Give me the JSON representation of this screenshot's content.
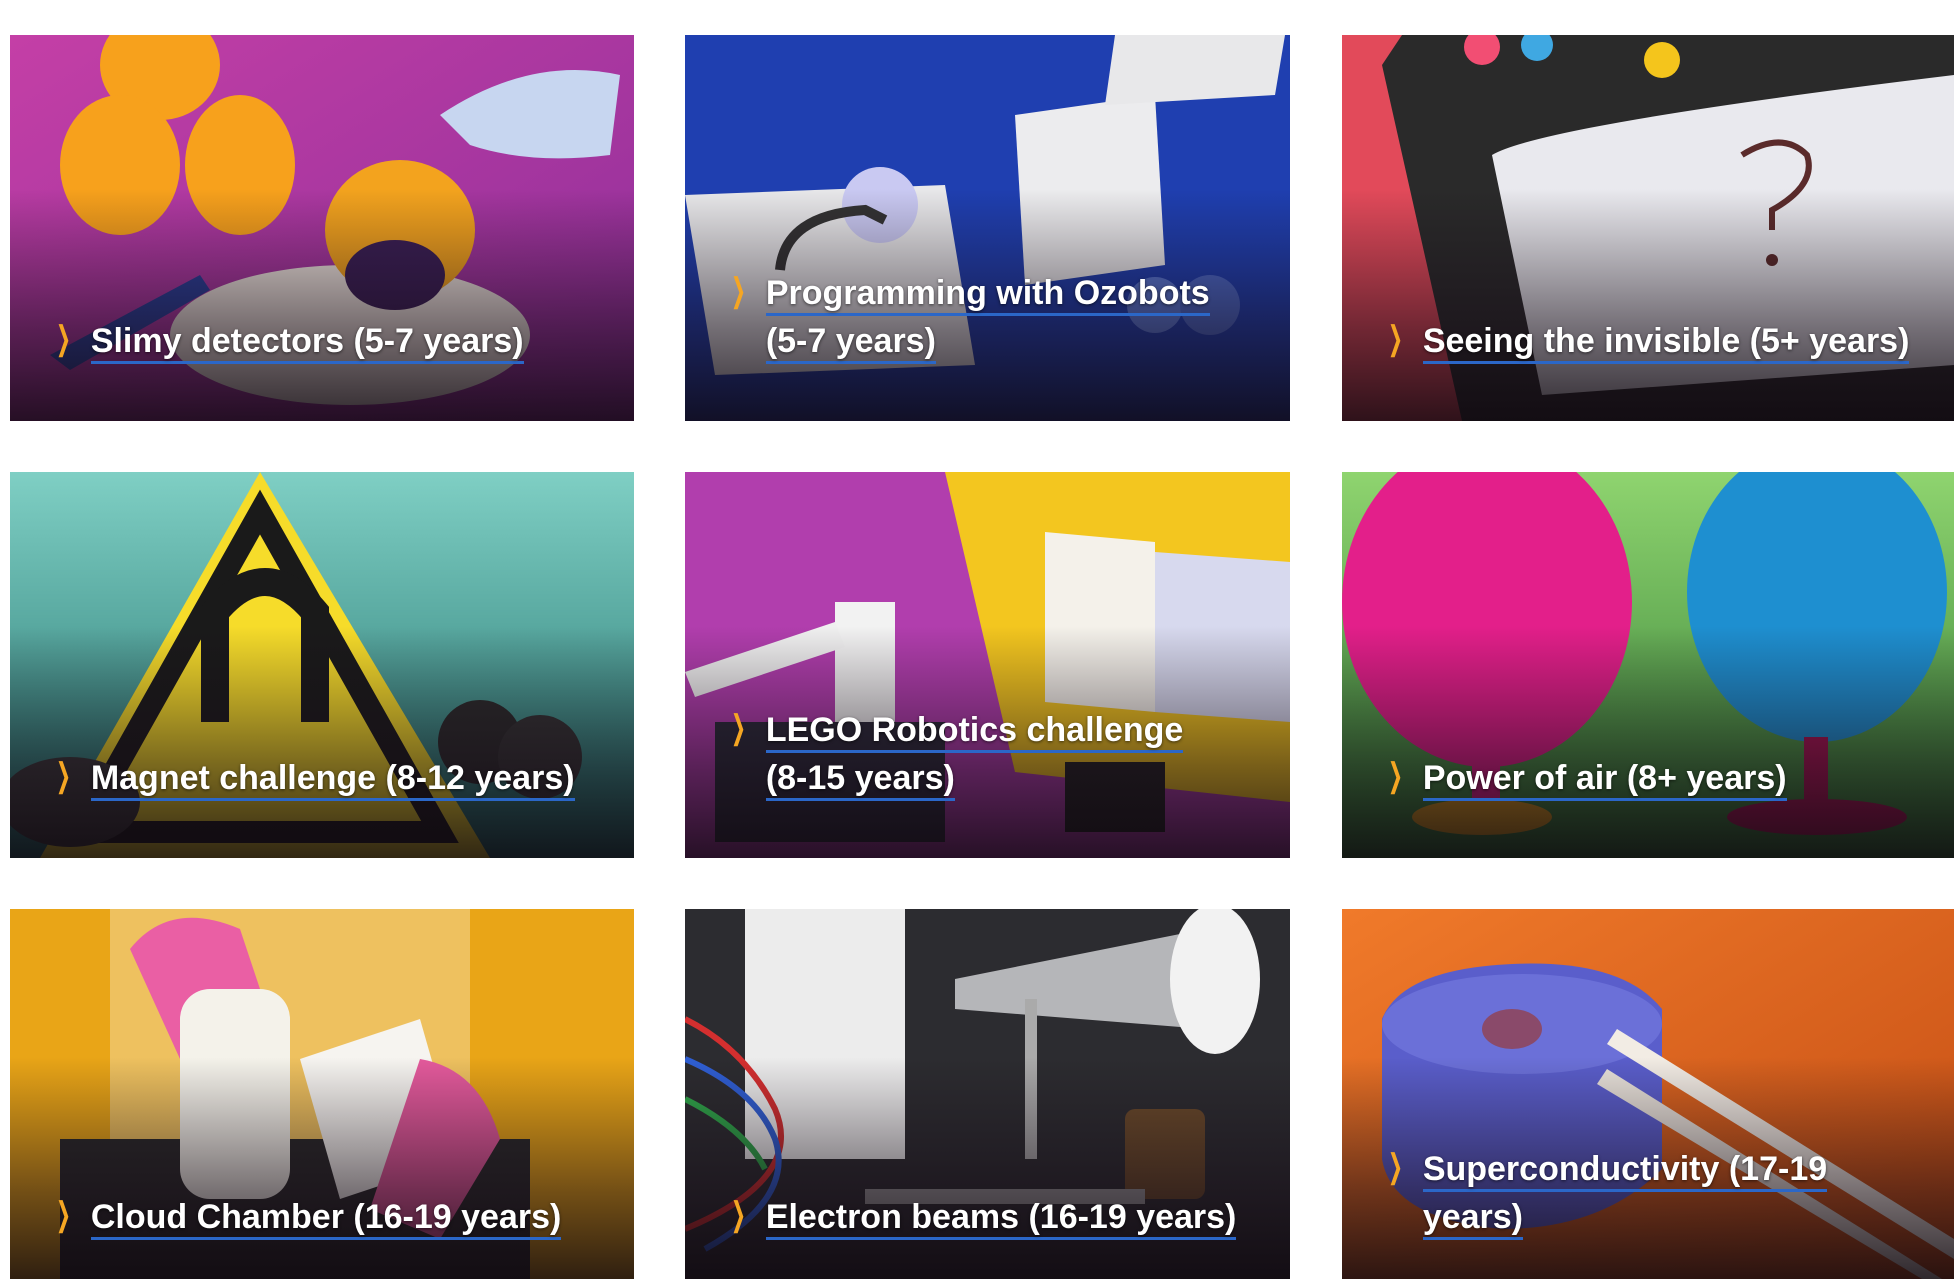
{
  "cards": [
    {
      "title": "Slimy detectors (5-7 years)",
      "bg": "#b8399a"
    },
    {
      "title": "Programming with Ozobots (5-7 years)",
      "line1": "Programming with Ozobots",
      "line2": "(5-7 years)",
      "bg": "#1d3fa8"
    },
    {
      "title": "Seeing the invisible (5+ years)",
      "bg": "#e04a5c"
    },
    {
      "title": "Magnet challenge (8-12 years)",
      "bg": "#2f8f84"
    },
    {
      "title": "LEGO Robotics challenge (8-15 years)",
      "line1": "LEGO Robotics challenge",
      "line2": "(8-15 years)",
      "bg": "#a83aa8"
    },
    {
      "title": "Power of air (8+ years)",
      "bg": "#4fa64a"
    },
    {
      "title": "Cloud Chamber (16-19 years)",
      "bg": "#e8a418"
    },
    {
      "title": "Electron beams (16-19 years)",
      "bg": "#2a2a2e"
    },
    {
      "title": "Superconductivity (17-19 years)",
      "line1": "Superconductivity (17-19",
      "line2": "years)",
      "bg": "#e0621c"
    }
  ],
  "icons": {
    "chevron": "chevron-right-icon"
  },
  "colors": {
    "accent_chevron": "#f5a623",
    "underline": "#2b67c8"
  }
}
